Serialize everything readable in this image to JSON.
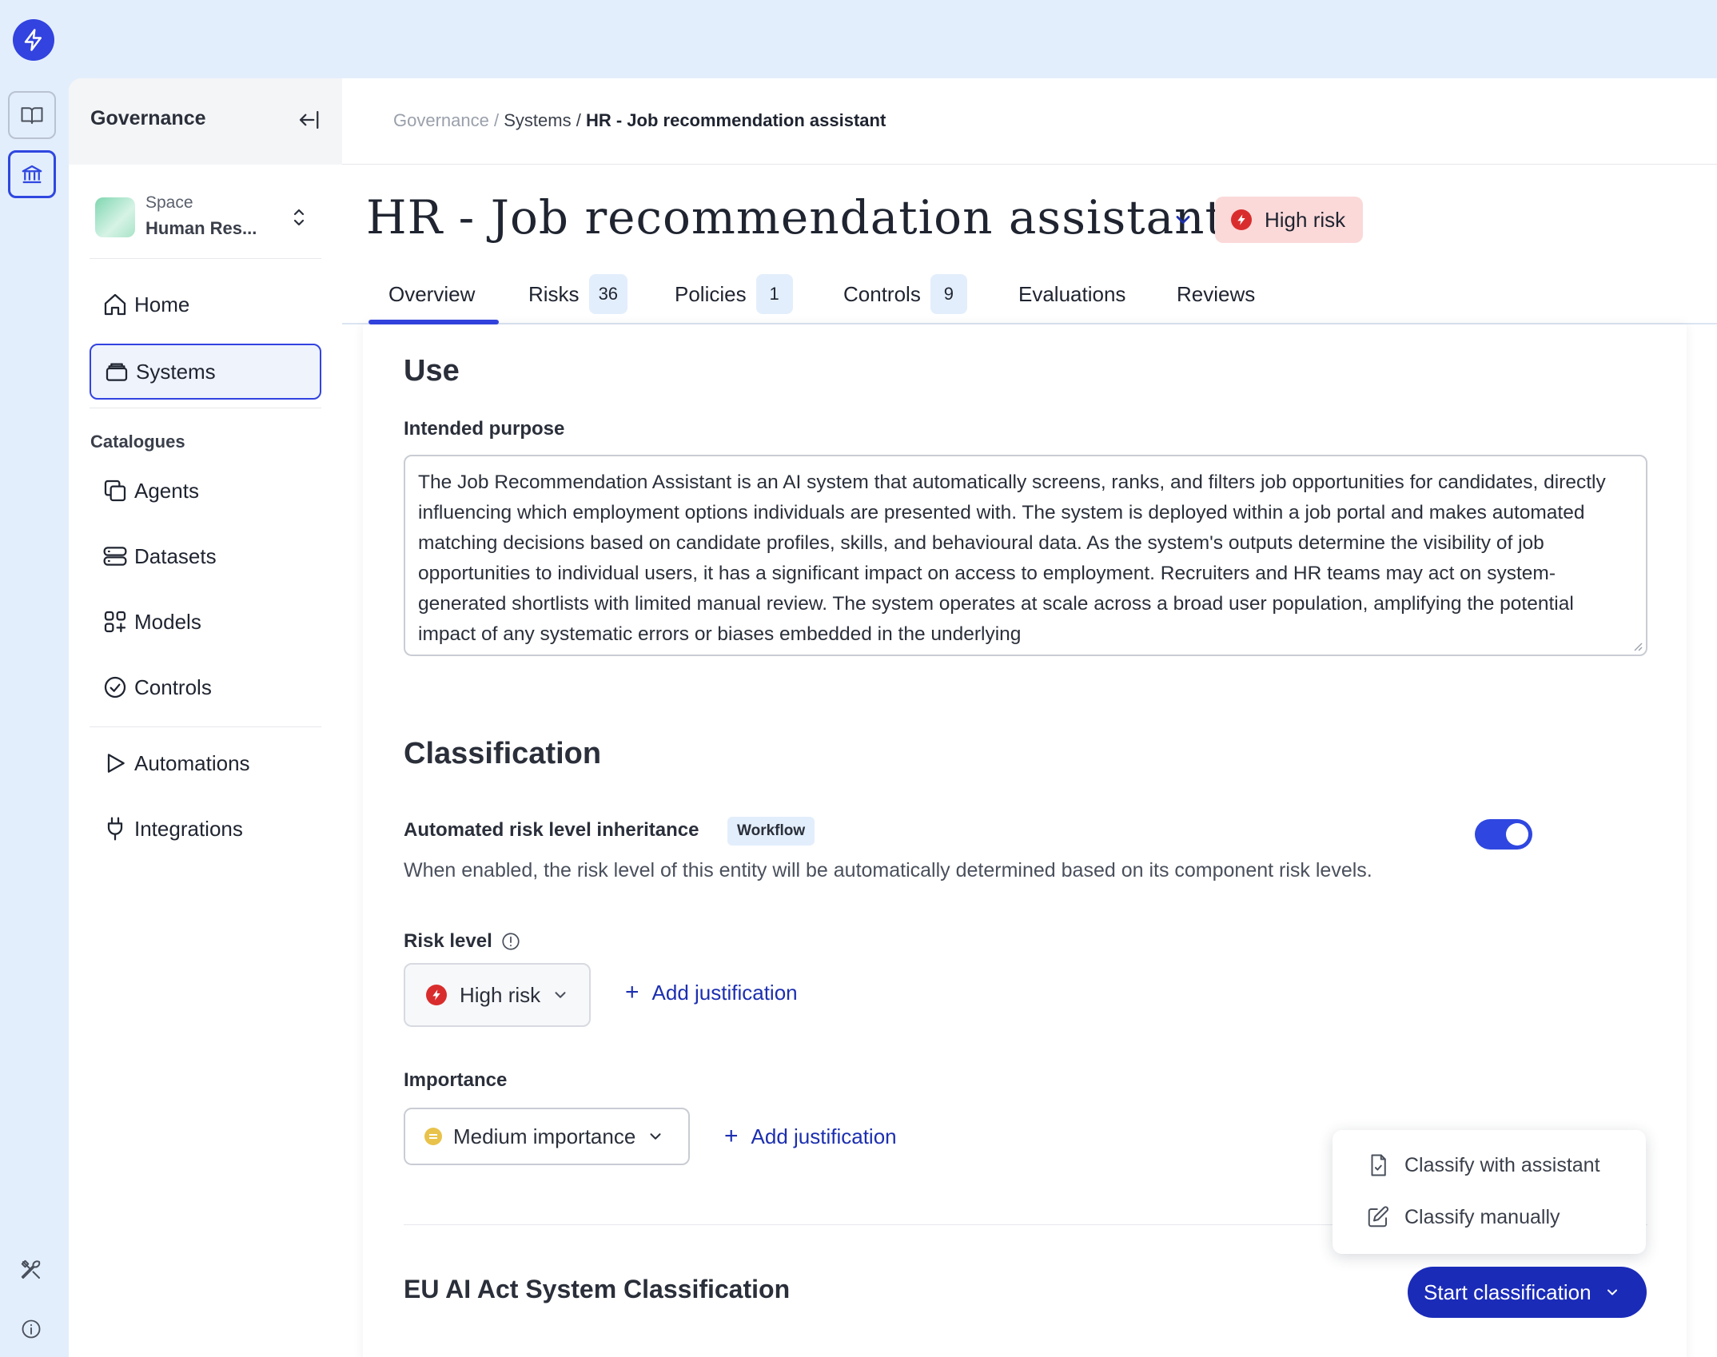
{
  "rail": {
    "logo_icon": "lightning-logo-icon",
    "items": [
      {
        "name": "book-icon",
        "active": false
      },
      {
        "name": "institution-icon",
        "active": true
      }
    ],
    "bottom": [
      "tools-icon",
      "info-icon"
    ]
  },
  "sidebar": {
    "title": "Governance",
    "space_label": "Space",
    "space_name": "Human Res...",
    "nav_main": [
      {
        "label": "Home",
        "icon": "home-icon"
      },
      {
        "label": "Systems",
        "icon": "systems-icon",
        "active": true
      }
    ],
    "catalogues_label": "Catalogues",
    "nav_catalogues": [
      {
        "label": "Agents",
        "icon": "agents-icon"
      },
      {
        "label": "Datasets",
        "icon": "datasets-icon"
      },
      {
        "label": "Models",
        "icon": "models-icon"
      },
      {
        "label": "Controls",
        "icon": "controls-icon"
      }
    ],
    "nav_other": [
      {
        "label": "Automations",
        "icon": "play-icon"
      },
      {
        "label": "Integrations",
        "icon": "plug-icon"
      }
    ]
  },
  "breadcrumb": {
    "root": "Governance",
    "sep1": "/",
    "middle": "Systems",
    "sep2": "/",
    "current": "HR - Job recommendation assistant"
  },
  "header": {
    "title": "HR - Job recommendation assistant",
    "risk_badge": "High risk"
  },
  "tabs": [
    {
      "label": "Overview",
      "active": true
    },
    {
      "label": "Risks",
      "count": "36"
    },
    {
      "label": "Policies",
      "count": "1"
    },
    {
      "label": "Controls",
      "count": "9"
    },
    {
      "label": "Evaluations"
    },
    {
      "label": "Reviews"
    }
  ],
  "use": {
    "heading": "Use",
    "intended_label": "Intended purpose",
    "intended_text": "The Job Recommendation Assistant is an AI system that automatically screens, ranks, and filters job opportunities for candidates, directly influencing which employment options individuals are presented with. The system is deployed within a job portal and makes automated matching decisions based on candidate profiles, skills, and behavioural data. As the system's outputs determine the visibility of job opportunities to individual users, it has a significant impact on access to employment. Recruiters and HR teams may act on system-generated shortlists with limited manual review. The system operates at scale across a broad user population, amplifying the potential impact of any systematic errors or biases embedded in the underlying"
  },
  "classification": {
    "heading": "Classification",
    "inheritance_label": "Automated risk level inheritance",
    "workflow_badge": "Workflow",
    "inheritance_enabled": true,
    "inheritance_desc": "When enabled, the risk level of this entity will be automatically determined based on its component risk levels.",
    "risk_level_label": "Risk level",
    "risk_level_value": "High risk",
    "add_justification": "Add justification",
    "importance_label": "Importance",
    "importance_value": "Medium importance",
    "eu_heading": "EU AI Act System Classification",
    "start_button": "Start classification",
    "menu": [
      {
        "label": "Classify with assistant",
        "icon": "document-check-icon"
      },
      {
        "label": "Classify manually",
        "icon": "pencil-icon"
      }
    ]
  },
  "colors": {
    "accent": "#2f47e0",
    "high_risk": "#d92d2d",
    "medium": "#e8c24a",
    "link": "#1c2fb0"
  }
}
